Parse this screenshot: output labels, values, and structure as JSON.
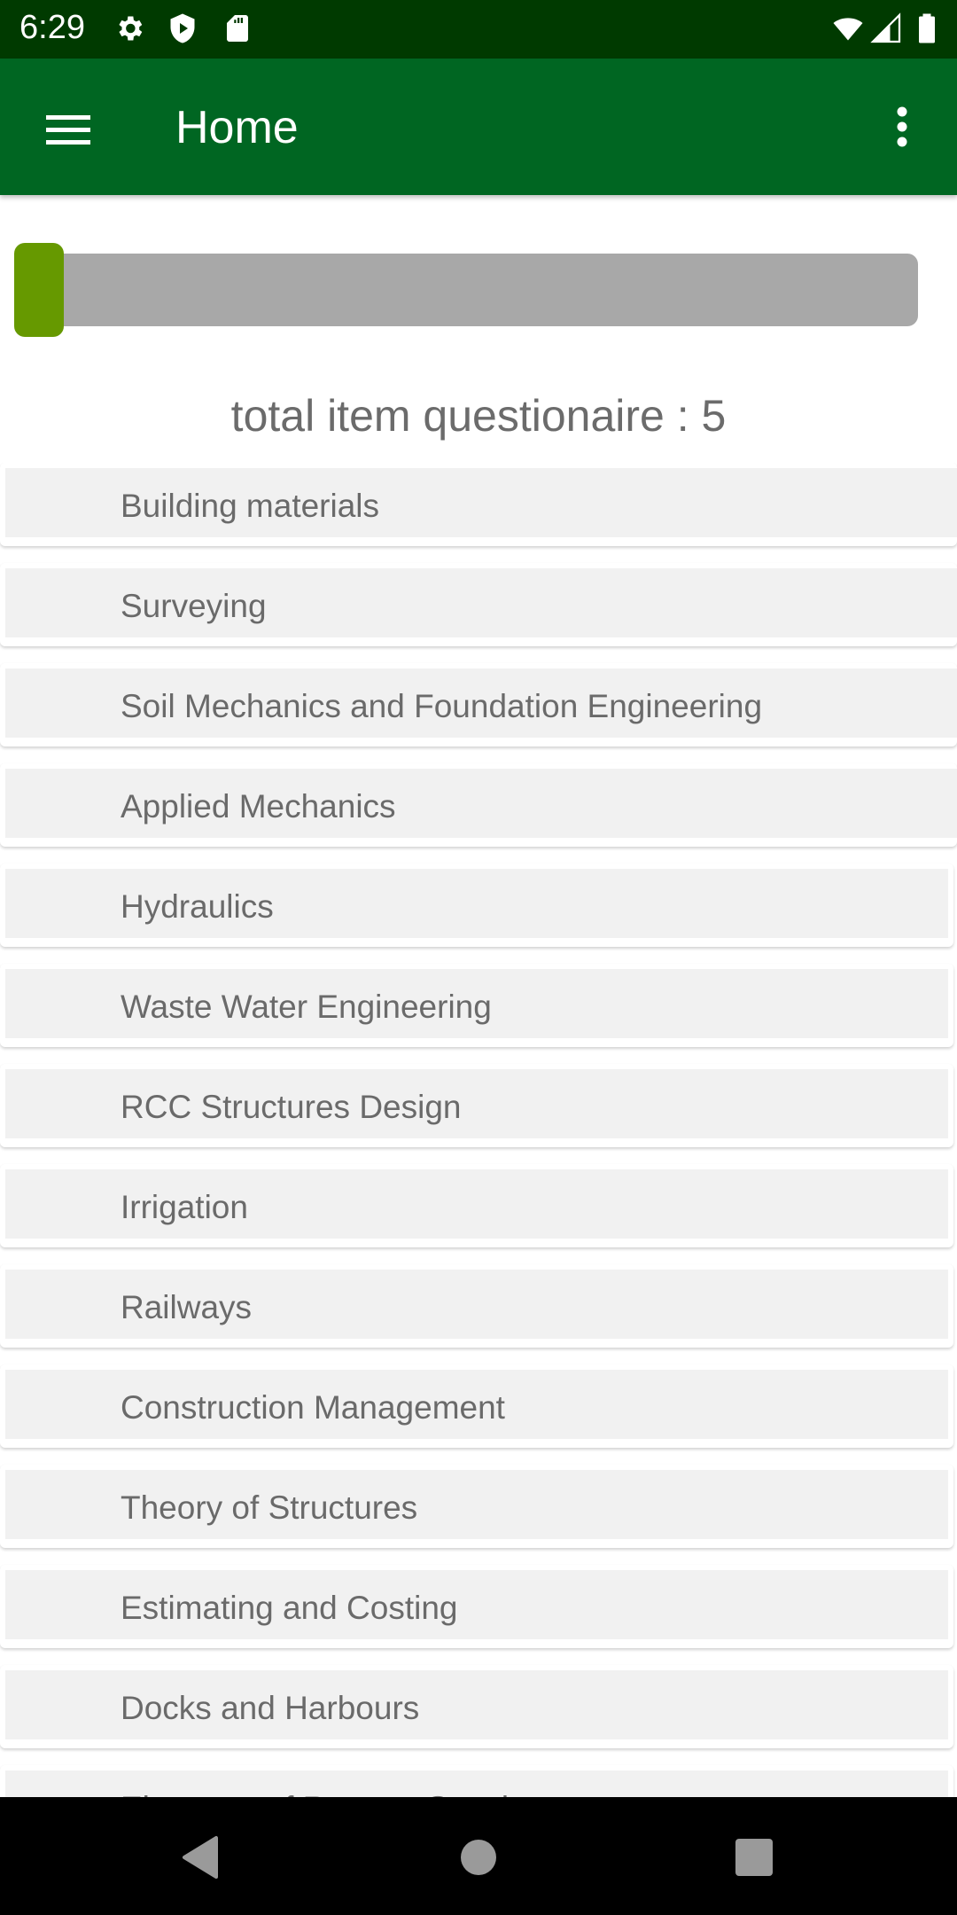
{
  "status_bar": {
    "time": "6:29",
    "left_icons": [
      "settings-icon",
      "shield-play-icon",
      "sd-card-icon"
    ],
    "right_icons": [
      "wifi-icon",
      "signal-icon",
      "battery-icon"
    ]
  },
  "app_bar": {
    "title": "Home",
    "menu_icon": "hamburger-menu-icon",
    "overflow_icon": "more-vertical-icon",
    "color": "#006622"
  },
  "progress": {
    "value_fraction": 0.04,
    "fill_color": "#669900",
    "track_color": "#a8a8a8"
  },
  "summary": {
    "text": "total item questionaire : 5"
  },
  "list": {
    "items": [
      {
        "label": "Building materials"
      },
      {
        "label": "Surveying"
      },
      {
        "label": "Soil Mechanics and Foundation Engineering"
      },
      {
        "label": "Applied Mechanics"
      },
      {
        "label": "Hydraulics"
      },
      {
        "label": "Waste Water Engineering"
      },
      {
        "label": " RCC Structures Design"
      },
      {
        "label": "Irrigation"
      },
      {
        "label": "Railways"
      },
      {
        "label": "Construction Management"
      },
      {
        "label": "Theory of Structures"
      },
      {
        "label": "Estimating and Costing"
      },
      {
        "label": "Docks and Harbours"
      },
      {
        "label": "Elements of Remote Sensing"
      }
    ]
  },
  "nav_bar": {
    "buttons": [
      "back-icon",
      "home-icon",
      "recents-icon"
    ]
  }
}
